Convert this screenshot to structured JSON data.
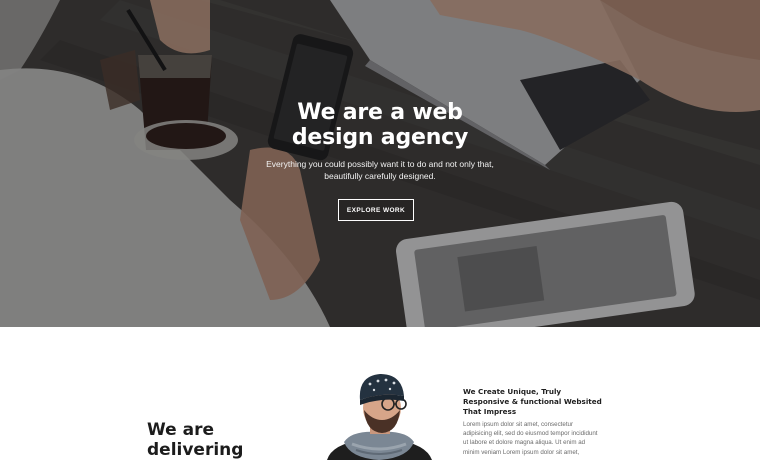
{
  "hero": {
    "title_lines": [
      "We are a web",
      "design agency"
    ],
    "subtitle_lines": [
      "Everything you could possibly want it to do and not only that,",
      "beautifully carefully designed."
    ],
    "cta_label": "EXPLORE WORK"
  },
  "about": {
    "heading_lines": [
      "We are",
      "delivering"
    ],
    "feature_title_lines": [
      "We Create Unique, Truly",
      "Responsive & functional Websited",
      "That Impress"
    ],
    "feature_body_lines": [
      "Lorem ipsum dolor sit amet, consectetur",
      "adipisicing elit, sed do eiusmod tempor incididunt",
      "ut labore et dolore magna aliqua. Ut enim ad",
      "minim veniam Lorem ipsum dolor sit amet,"
    ]
  },
  "colors": {
    "hero_overlay": "#2e2c2a",
    "text_light": "#ffffff",
    "heading_dark": "#1c1c1c",
    "body_gray": "#6b6b6b"
  }
}
